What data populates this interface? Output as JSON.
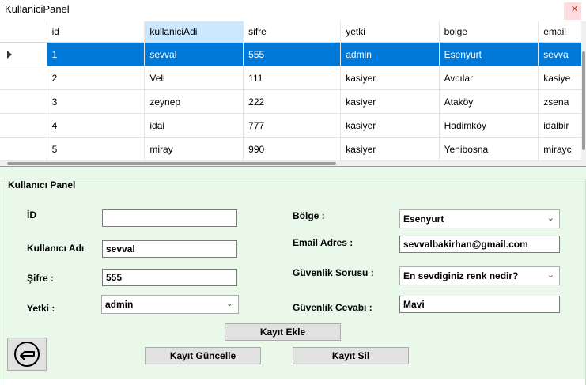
{
  "window": {
    "title": "KullaniciPanel",
    "close_glyph": "×"
  },
  "grid": {
    "columns": [
      "id",
      "kullaniciAdi",
      "sifre",
      "yetki",
      "bolge",
      "email"
    ],
    "rows": [
      [
        "1",
        "sevval",
        "555",
        "admin",
        "Esenyurt",
        "sevva"
      ],
      [
        "2",
        "Veli",
        "111",
        "kasiyer",
        "Avcılar",
        "kasiye"
      ],
      [
        "3",
        "zeynep",
        "222",
        "kasiyer",
        "Ataköy",
        "zsena"
      ],
      [
        "4",
        "idal",
        "777",
        "kasiyer",
        "Hadimköy",
        "idalbir"
      ],
      [
        "5",
        "miray",
        "990",
        "kasiyer",
        "Yenibosna",
        "mirayc"
      ]
    ]
  },
  "panel": {
    "group_title": "Kullanıcı Panel",
    "labels": {
      "id": "İD",
      "username": "Kullanıcı Adı",
      "password": "Şifre :",
      "role": "Yetki :",
      "region": "Bölge :",
      "email": "Email Adres :",
      "security_question": "Güvenlik Sorusu :",
      "security_answer": "Güvenlik Cevabı :"
    },
    "values": {
      "id": "",
      "username": "sevval",
      "password": "555",
      "role": "admin",
      "region": "Esenyurt",
      "email": "sevvalbakirhan@gmail.com",
      "security_question": "En sevdiginiz renk nedir?",
      "security_answer": "Mavi"
    },
    "buttons": {
      "add": "Kayıt Ekle",
      "update": "Kayıt Güncelle",
      "delete": "Kayıt Sil"
    },
    "back_icon": "back-arrow-icon"
  },
  "colors": {
    "selection": "#0078d7",
    "header_selected": "#cce8ff",
    "panel_bg": "#e9f8e8"
  }
}
